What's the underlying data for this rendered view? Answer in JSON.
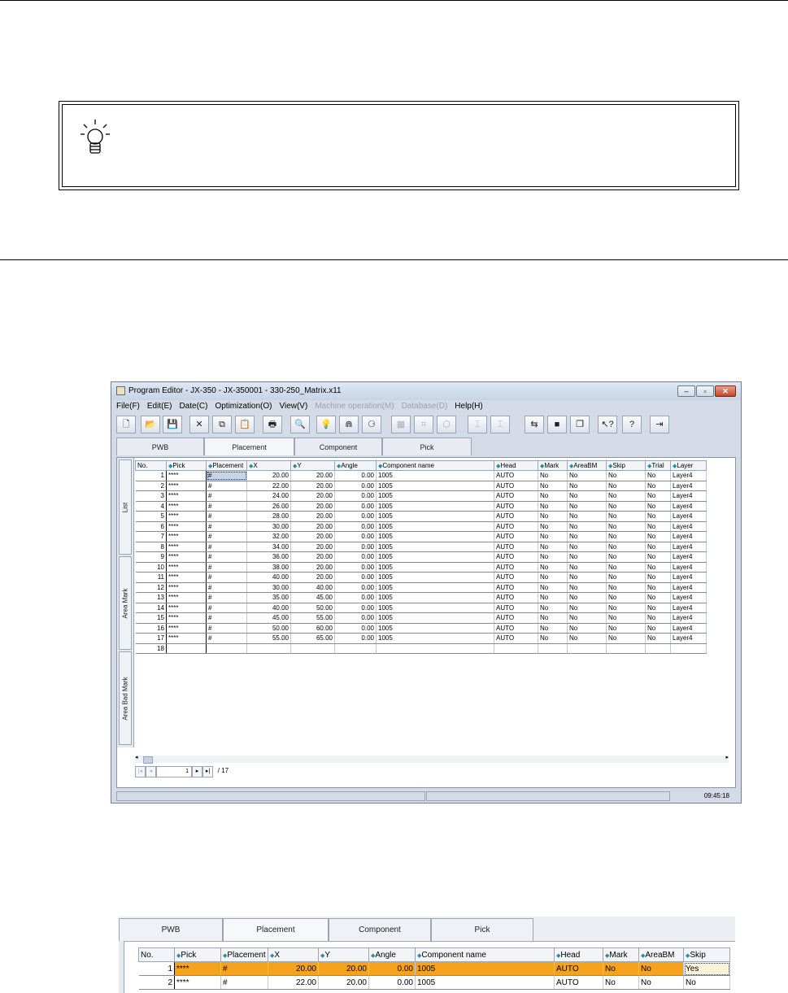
{
  "window": {
    "title": "Program Editor - JX-350 - JX-350001 - 330-250_Matrix.x11",
    "menu": [
      {
        "label": "File(F)",
        "enabled": true
      },
      {
        "label": "Edit(E)",
        "enabled": true
      },
      {
        "label": "Date(C)",
        "enabled": true
      },
      {
        "label": "Optimization(O)",
        "enabled": true
      },
      {
        "label": "View(V)",
        "enabled": true
      },
      {
        "label": "Machine operation(M)",
        "enabled": false
      },
      {
        "label": "Database(D)",
        "enabled": false
      },
      {
        "label": "Help(H)",
        "enabled": true
      }
    ],
    "toolbar": [
      {
        "icon": "new-file-icon",
        "glyph": "🗋"
      },
      {
        "icon": "open-folder-icon",
        "glyph": "📂"
      },
      {
        "icon": "save-icon",
        "glyph": "💾"
      },
      {
        "icon": "delete-icon",
        "glyph": "✕"
      },
      {
        "icon": "copy-icon",
        "glyph": "⧉"
      },
      {
        "icon": "paste-icon",
        "glyph": "📋"
      },
      {
        "icon": "print-icon",
        "glyph": "🖶"
      },
      {
        "icon": "find-icon",
        "glyph": "🔍"
      },
      {
        "icon": "lightbulb-icon",
        "glyph": "💡"
      },
      {
        "icon": "optimize-icon",
        "glyph": "⋒"
      },
      {
        "icon": "components-icon",
        "glyph": "⚆"
      },
      {
        "icon": "grid-icon",
        "glyph": "▦"
      },
      {
        "icon": "feeder-icon",
        "glyph": "⌗"
      },
      {
        "icon": "package-icon",
        "glyph": "⬡"
      },
      {
        "icon": "machine-a-icon",
        "glyph": "⌶"
      },
      {
        "icon": "machine-b-icon",
        "glyph": "⌶"
      },
      {
        "icon": "transfer-icon",
        "glyph": "⇆"
      },
      {
        "icon": "stop-icon",
        "glyph": "■"
      },
      {
        "icon": "layers-icon",
        "glyph": "❐"
      },
      {
        "icon": "context-help-icon",
        "glyph": "↖?"
      },
      {
        "icon": "help-icon",
        "glyph": "?"
      },
      {
        "icon": "exit-icon",
        "glyph": "⇥"
      }
    ],
    "tabs": [
      "PWB",
      "Placement",
      "Component",
      "Pick"
    ],
    "active_tab": "Placement",
    "side_tabs": [
      "List",
      "Area Mark",
      "Area Bad Mark"
    ],
    "columns": [
      "No.",
      "Pick",
      "Placement",
      "X",
      "Y",
      "Angle",
      "Component name",
      "Head",
      "Mark",
      "AreaBM",
      "Skip",
      "Trial",
      "Layer"
    ],
    "rows": [
      [
        "1",
        "****",
        "#",
        "20.00",
        "20.00",
        "0.00",
        "1005",
        "AUTO",
        "No",
        "No",
        "No",
        "No",
        "Layer4"
      ],
      [
        "2",
        "****",
        "#",
        "22.00",
        "20.00",
        "0.00",
        "1005",
        "AUTO",
        "No",
        "No",
        "No",
        "No",
        "Layer4"
      ],
      [
        "3",
        "****",
        "#",
        "24.00",
        "20.00",
        "0.00",
        "1005",
        "AUTO",
        "No",
        "No",
        "No",
        "No",
        "Layer4"
      ],
      [
        "4",
        "****",
        "#",
        "26.00",
        "20.00",
        "0.00",
        "1005",
        "AUTO",
        "No",
        "No",
        "No",
        "No",
        "Layer4"
      ],
      [
        "5",
        "****",
        "#",
        "28.00",
        "20.00",
        "0.00",
        "1005",
        "AUTO",
        "No",
        "No",
        "No",
        "No",
        "Layer4"
      ],
      [
        "6",
        "****",
        "#",
        "30.00",
        "20.00",
        "0.00",
        "1005",
        "AUTO",
        "No",
        "No",
        "No",
        "No",
        "Layer4"
      ],
      [
        "7",
        "****",
        "#",
        "32.00",
        "20.00",
        "0.00",
        "1005",
        "AUTO",
        "No",
        "No",
        "No",
        "No",
        "Layer4"
      ],
      [
        "8",
        "****",
        "#",
        "34.00",
        "20.00",
        "0.00",
        "1005",
        "AUTO",
        "No",
        "No",
        "No",
        "No",
        "Layer4"
      ],
      [
        "9",
        "****",
        "#",
        "36.00",
        "20.00",
        "0.00",
        "1005",
        "AUTO",
        "No",
        "No",
        "No",
        "No",
        "Layer4"
      ],
      [
        "10",
        "****",
        "#",
        "38.00",
        "20.00",
        "0.00",
        "1005",
        "AUTO",
        "No",
        "No",
        "No",
        "No",
        "Layer4"
      ],
      [
        "11",
        "****",
        "#",
        "40.00",
        "20.00",
        "0.00",
        "1005",
        "AUTO",
        "No",
        "No",
        "No",
        "No",
        "Layer4"
      ],
      [
        "12",
        "****",
        "#",
        "30.00",
        "40.00",
        "0.00",
        "1005",
        "AUTO",
        "No",
        "No",
        "No",
        "No",
        "Layer4"
      ],
      [
        "13",
        "****",
        "#",
        "35.00",
        "45.00",
        "0.00",
        "1005",
        "AUTO",
        "No",
        "No",
        "No",
        "No",
        "Layer4"
      ],
      [
        "14",
        "****",
        "#",
        "40.00",
        "50.00",
        "0.00",
        "1005",
        "AUTO",
        "No",
        "No",
        "No",
        "No",
        "Layer4"
      ],
      [
        "15",
        "****",
        "#",
        "45.00",
        "55.00",
        "0.00",
        "1005",
        "AUTO",
        "No",
        "No",
        "No",
        "No",
        "Layer4"
      ],
      [
        "16",
        "****",
        "#",
        "50.00",
        "60.00",
        "0.00",
        "1005",
        "AUTO",
        "No",
        "No",
        "No",
        "No",
        "Layer4"
      ],
      [
        "17",
        "****",
        "#",
        "55.00",
        "65.00",
        "0.00",
        "1005",
        "AUTO",
        "No",
        "No",
        "No",
        "No",
        "Layer4"
      ],
      [
        "18",
        "",
        "",
        "",
        "",
        "",
        "",
        "",
        "",
        "",
        "",
        "",
        ""
      ]
    ],
    "pager": {
      "current": "1",
      "total": "/ 17"
    },
    "status_time": "09:45:18"
  },
  "zoom": {
    "tabs": [
      "PWB",
      "Placement",
      "Component",
      "Pick"
    ],
    "active_tab": "Placement",
    "columns": [
      "No.",
      "Pick",
      "Placement",
      "X",
      "Y",
      "Angle",
      "Component name",
      "Head",
      "Mark",
      "AreaBM",
      "Skip"
    ],
    "rows": [
      [
        "1",
        "****",
        "#",
        "20.00",
        "20.00",
        "0.00",
        "1005",
        "AUTO",
        "No",
        "No",
        "Yes"
      ],
      [
        "2",
        "****",
        "#",
        "22.00",
        "20.00",
        "0.00",
        "1005",
        "AUTO",
        "No",
        "No",
        "No"
      ]
    ],
    "highlight_color": "#f5a21d"
  }
}
